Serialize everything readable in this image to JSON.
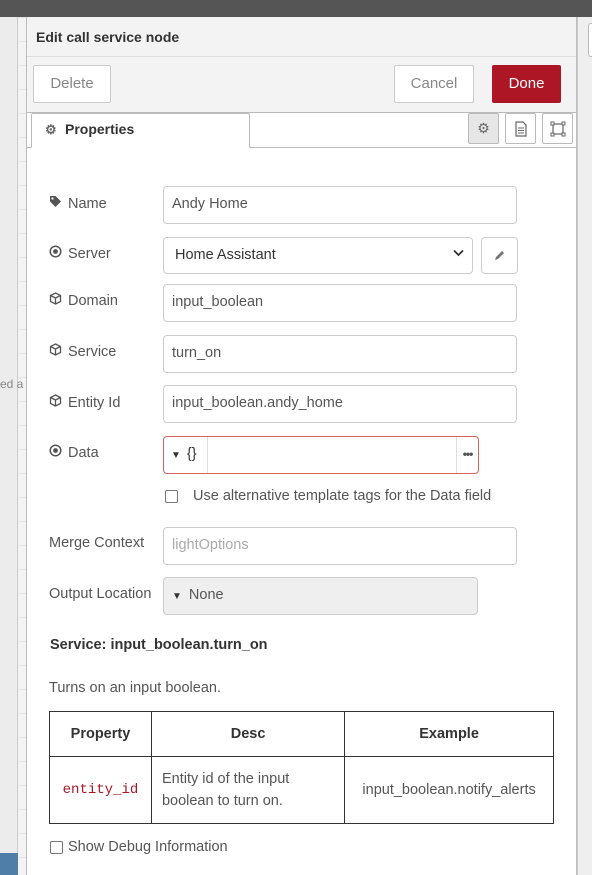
{
  "background": {
    "stub_text": "ed a"
  },
  "dialog": {
    "title": "Edit call service node",
    "buttons": {
      "delete": "Delete",
      "cancel": "Cancel",
      "done": "Done"
    },
    "accent_color": "#ad1625"
  },
  "tabs": {
    "properties_label": "Properties",
    "icons": [
      "gear-icon",
      "description-icon",
      "appearance-icon"
    ]
  },
  "form": {
    "name": {
      "label": "Name",
      "value": "Andy Home",
      "icon": "tag-icon"
    },
    "server": {
      "label": "Server",
      "value": "Home Assistant",
      "icon": "dot-circle-icon"
    },
    "domain": {
      "label": "Domain",
      "value": "input_boolean",
      "icon": "cube-icon"
    },
    "service": {
      "label": "Service",
      "value": "turn_on",
      "icon": "cube-icon"
    },
    "entity_id": {
      "label": "Entity Id",
      "value": "input_boolean.andy_home",
      "icon": "cube-icon"
    },
    "data": {
      "label": "Data",
      "type_value": "{}",
      "value": "",
      "icon": "dot-circle-icon"
    },
    "alt_tags": {
      "label": "Use alternative template tags for the Data field",
      "checked": false
    },
    "merge_context": {
      "label": "Merge Context",
      "value": "",
      "placeholder": "lightOptions"
    },
    "output_location": {
      "label": "Output Location",
      "value": "None"
    }
  },
  "service_info": {
    "title": "Service: input_boolean.turn_on",
    "description": "Turns on an input boolean.",
    "table": {
      "headers": [
        "Property",
        "Desc",
        "Example"
      ],
      "rows": [
        {
          "property": "entity_id",
          "desc": "Entity id of the input boolean to turn on.",
          "example": "input_boolean.notify_alerts"
        }
      ]
    }
  },
  "debug": {
    "label": "Show Debug Information",
    "checked": false
  }
}
